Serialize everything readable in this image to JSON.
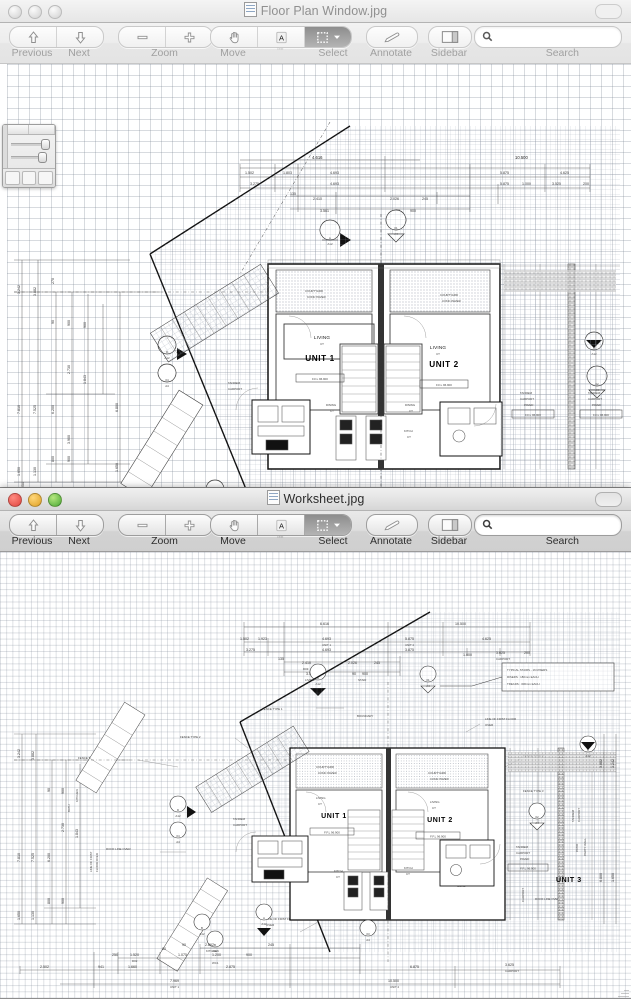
{
  "windows": [
    {
      "id": "floor-plan-window",
      "title": "Floor Plan Window.jpg",
      "active": false,
      "toolbar": {
        "previous_label": "Previous",
        "next_label": "Next",
        "zoom_label": "Zoom",
        "move_label": "Move",
        "text_label": "Text",
        "select_label": "Select",
        "annotate_label": "Annotate",
        "sidebar_label": "Sidebar",
        "search_label": "Search",
        "search_value": "",
        "search_placeholder": "",
        "zoom_out_icon": "minus-icon",
        "zoom_in_icon": "plus-icon",
        "move_icon": "hand-icon",
        "text_icon": "text-A-icon",
        "select_icon": "marquee-select-icon",
        "select_menu_icon": "chevron-down-icon",
        "annotate_icon": "pencil-icon",
        "sidebar_icon": "sidebar-panel-icon",
        "search_icon": "magnifier-icon",
        "previous_icon": "arrow-up-icon",
        "next_icon": "arrow-down-icon",
        "selected_tool": "Select"
      }
    },
    {
      "id": "worksheet-window",
      "title": "Worksheet.jpg",
      "active": true,
      "toolbar": {
        "previous_label": "Previous",
        "next_label": "Next",
        "zoom_label": "Zoom",
        "move_label": "Move",
        "text_label": "Text",
        "select_label": "Select",
        "annotate_label": "Annotate",
        "sidebar_label": "Sidebar",
        "search_label": "Search",
        "search_value": "",
        "search_placeholder": "",
        "zoom_out_icon": "minus-icon",
        "zoom_in_icon": "plus-icon",
        "move_icon": "hand-icon",
        "text_icon": "text-A-icon",
        "select_icon": "marquee-select-icon",
        "select_menu_icon": "chevron-down-icon",
        "annotate_icon": "pencil-icon",
        "sidebar_icon": "sidebar-panel-icon",
        "search_icon": "magnifier-icon",
        "previous_icon": "arrow-up-icon",
        "next_icon": "arrow-down-icon",
        "selected_tool": "Select"
      }
    }
  ],
  "palette": {
    "name": "adjust-palette",
    "tabs": 2,
    "sliders": 2,
    "swatches": 3
  },
  "drawing": {
    "rooms": {
      "unit1": "UNIT 1",
      "unit2": "UNIT 2",
      "unit3": "UNIT 3",
      "living": "LIVING",
      "dining": "DINING",
      "kitch": "KITCH",
      "store": "STORE",
      "lobby": "LOBBY",
      "wc": "WC",
      "courtyard": "COURTYARD",
      "courtyard_sub": "CONC PAVER",
      "tandem_carport": "TANDEM CARPORT",
      "carport_sub": "PAVED",
      "ffl": "F.F.L  96.900",
      "ct": "CT",
      "conc": "CONC"
    },
    "notes": {
      "boundary": "BOUNDARY",
      "boundary_left": "BOUNDARY 33.34",
      "fence_type_1": "FENCE TYPE 1",
      "fence_type_2": "FENCE TYPE 2",
      "fence_type_3": "FENCE TYPE 3",
      "line_first_floor": "LINE OF FIRST FLOOR",
      "line_first_floor_over": "LINE OF FIRST FLOOR OVER",
      "roof_line_over": "ROOF LINE OVER",
      "party_wall": "PARTY WALL",
      "carport": "CARPORT",
      "patio": "PATIO",
      "stair_note_1": "TYPICAL STAIRS - 16 RISERS",
      "stair_note_2": "RISERS  :  180mm EACH",
      "stair_note_3": "TREADS  :  300mm EACH"
    },
    "callouts": [
      {
        "top": "A",
        "bottom": "A12"
      },
      {
        "top": "B",
        "bottom": "A12"
      },
      {
        "top": "C",
        "bottom": "A12"
      },
      {
        "top": "D",
        "bottom": "A12"
      },
      {
        "top": "01",
        "bottom": "A4"
      },
      {
        "top": "02",
        "bottom": "A4"
      },
      {
        "top": "03",
        "bottom": "A4"
      },
      {
        "top": "04",
        "bottom": "A4"
      }
    ],
    "dims_top": [
      "4.616",
      "6.616",
      "10.500",
      "1.502",
      "1.923",
      "4.693",
      "5.875",
      "4.625",
      "3.275",
      "3.875",
      "1.000",
      "3.625",
      "200",
      "2.410",
      "2.026",
      "245",
      "3.561",
      "90",
      "900",
      "135",
      "80"
    ],
    "dims_bottom": [
      "2.502",
      "941",
      "1.660",
      "2.875",
      "6.875",
      "3.625",
      "7.969",
      "10.500",
      "2.862",
      "245",
      "1.520",
      "1.075",
      "1.200",
      "900",
      "250",
      "80",
      "90"
    ],
    "dims_left": [
      "3.242",
      "3.882",
      "7.810",
      "7.525",
      "6.200",
      "2.730",
      "1.843",
      "6.800",
      "1.650",
      "1.130",
      "800",
      "900",
      "270",
      "90",
      "250",
      "1.650",
      "900",
      "3.900"
    ],
    "dims_right": [
      "3.882",
      "3.242",
      "1.130",
      "1.650",
      "6.800",
      "2.730"
    ],
    "labels_dim": {
      "unit1": "UNIT 1",
      "unit2": "UNIT 2",
      "carport": "CARPORT",
      "kitchen": "KITCHEN",
      "wc1": "WC1",
      "d02": "D02",
      "living": "LIVING",
      "stair": "STAIR"
    }
  }
}
